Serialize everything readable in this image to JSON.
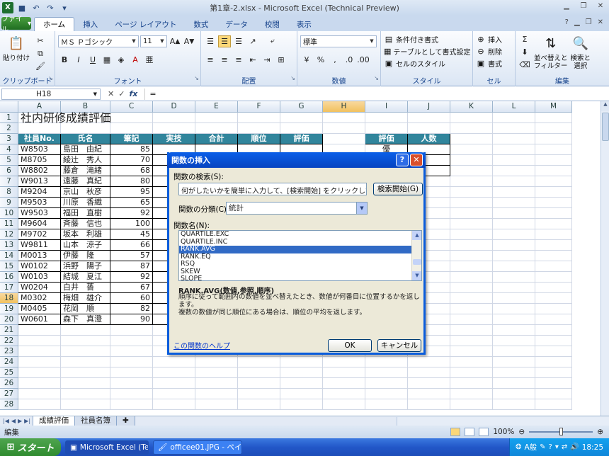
{
  "window": {
    "title": "第1章-2.xlsx - Microsoft Excel (Technical Preview)"
  },
  "office_button_label": "ファイル",
  "ribbon_tabs": [
    "ホーム",
    "挿入",
    "ページ レイアウト",
    "数式",
    "データ",
    "校閲",
    "表示"
  ],
  "ribbon": {
    "clipboard": {
      "label": "クリップボード",
      "paste": "貼り付け"
    },
    "font": {
      "label": "フォント",
      "name": "ＭＳ Ｐゴシック",
      "size": "11"
    },
    "alignment": {
      "label": "配置"
    },
    "number": {
      "label": "数値",
      "format": "標準"
    },
    "styles": {
      "label": "スタイル",
      "conditional": "条件付き書式",
      "table": "テーブルとして書式設定",
      "cell_styles": "セルのスタイル"
    },
    "cells": {
      "label": "セル",
      "insert": "挿入",
      "delete": "削除",
      "format": "書式"
    },
    "editing": {
      "label": "編集",
      "sort": "並べ替えと\nフィルター",
      "find": "検索と\n選択"
    }
  },
  "formula_bar": {
    "name_box": "H18",
    "content": "="
  },
  "columns": [
    "A",
    "B",
    "C",
    "D",
    "E",
    "F",
    "G",
    "H",
    "I",
    "J",
    "K",
    "L",
    "M"
  ],
  "rows": [
    "1",
    "2",
    "3",
    "4",
    "5",
    "6",
    "7",
    "8",
    "9",
    "10",
    "11",
    "12",
    "13",
    "14",
    "15",
    "16",
    "17",
    "18",
    "19",
    "20",
    "21",
    "22",
    "23",
    "24",
    "25",
    "26",
    "27",
    "28"
  ],
  "sheet": {
    "title": "社内研修成績評価",
    "headers": [
      "社員No.",
      "氏名",
      "筆記",
      "実技",
      "合計",
      "順位",
      "評価"
    ],
    "records": [
      {
        "id": "W8503",
        "name": "島田　由紀",
        "score": "85"
      },
      {
        "id": "M8705",
        "name": "綾辻　秀人",
        "score": "70"
      },
      {
        "id": "W8802",
        "name": "藤倉　滝緒",
        "score": "68"
      },
      {
        "id": "W9013",
        "name": "遠藤　真紀",
        "score": "80"
      },
      {
        "id": "M9204",
        "name": "京山　秋彦",
        "score": "95"
      },
      {
        "id": "M9503",
        "name": "川原　香織",
        "score": "65"
      },
      {
        "id": "W9503",
        "name": "福田　直樹",
        "score": "92"
      },
      {
        "id": "M9604",
        "name": "斉藤　信也",
        "score": "100"
      },
      {
        "id": "M9702",
        "name": "坂本　利雄",
        "score": "45"
      },
      {
        "id": "W9811",
        "name": "山本　涼子",
        "score": "66"
      },
      {
        "id": "M0013",
        "name": "伊藤　隆",
        "score": "57"
      },
      {
        "id": "W0102",
        "name": "浜野　陽子",
        "score": "87"
      },
      {
        "id": "W0103",
        "name": "結城　夏江",
        "score": "92"
      },
      {
        "id": "W0204",
        "name": "白井　薔",
        "score": "67"
      },
      {
        "id": "M0302",
        "name": "梅畑　雄介",
        "score": "60"
      },
      {
        "id": "M0405",
        "name": "花岡　順",
        "score": "82"
      },
      {
        "id": "W0601",
        "name": "森下　真澄",
        "score": "90"
      }
    ],
    "eval_headers": [
      "評価",
      "人数"
    ],
    "eval_first": "優"
  },
  "sheet_tabs": [
    "成績評価",
    "社員名簿"
  ],
  "status": {
    "mode": "編集",
    "zoom": "100%"
  },
  "taskbar": {
    "start": "スタート",
    "items": [
      "Microsoft Excel (Tec...",
      "officee01.JPG - ペイ..."
    ],
    "ime": "A般",
    "clock": "18:25"
  },
  "dialog": {
    "title": "関数の挿入",
    "search_label": "関数の検索(S):",
    "search_value": "何がしたいかを簡単に入力して、[検索開始] をクリックしてください。",
    "search_button": "検索開始(G)",
    "category_label": "関数の分類(C):",
    "category_value": "統計",
    "list_label": "関数名(N):",
    "functions": [
      "QUARTILE.EXC",
      "QUARTILE.INC",
      "RANK.AVG",
      "RANK.EQ",
      "RSQ",
      "SKEW",
      "SLOPE"
    ],
    "selected": "RANK.AVG",
    "syntax": "RANK.AVG(数値,参照,順序)",
    "desc1": "順序に従って範囲内の数値を並べ替えたとき、数値が何番目に位置するかを返します。",
    "desc2": "複数の数値が同じ順位にある場合は、順位の平均を返します。",
    "help_link": "この関数のヘルプ",
    "ok": "OK",
    "cancel": "キャンセル"
  }
}
